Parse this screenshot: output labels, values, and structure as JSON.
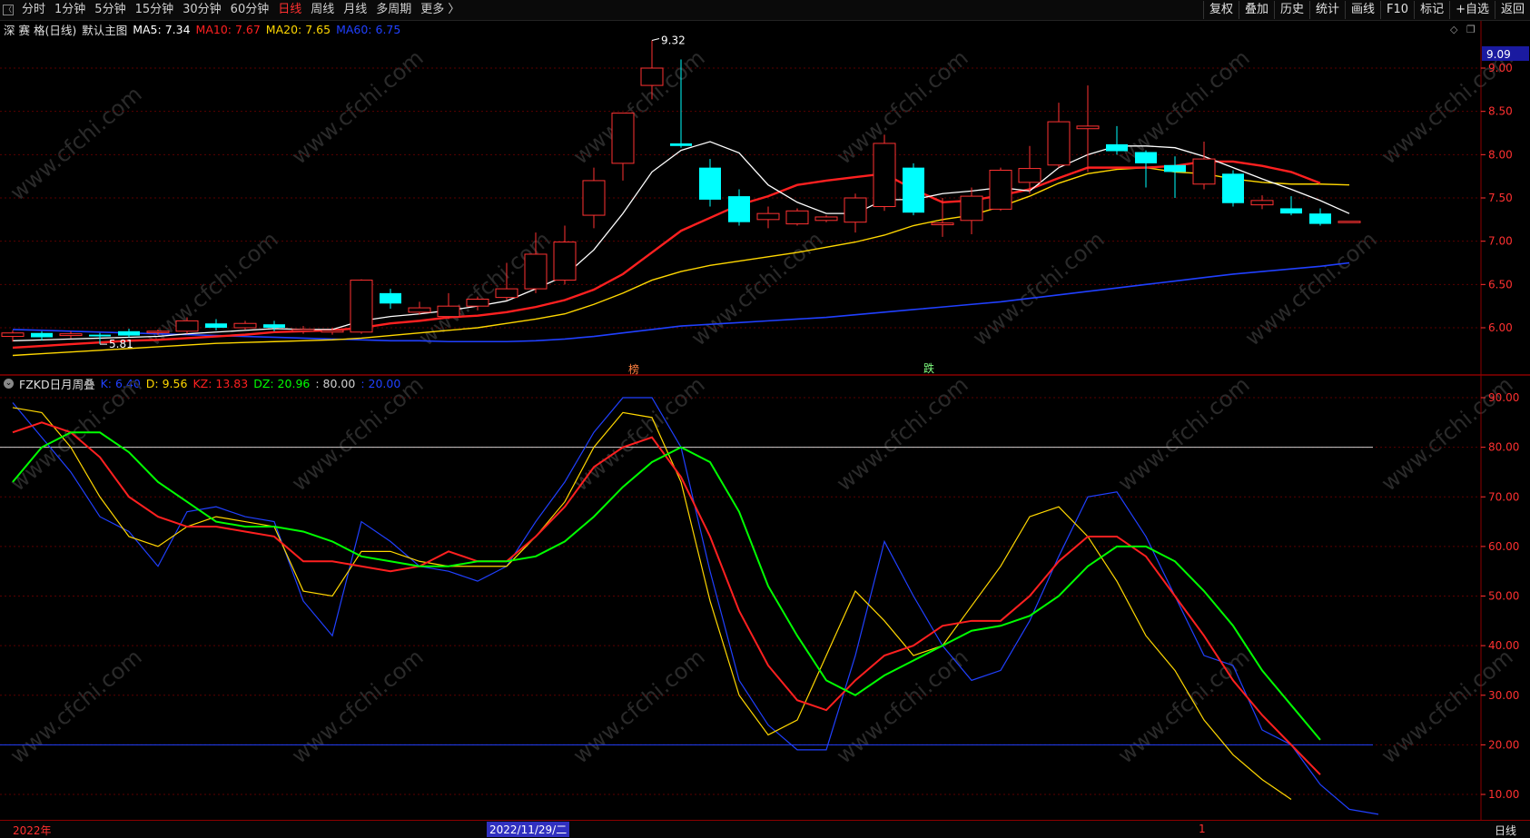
{
  "topbar": {
    "periods": [
      "分时",
      "1分钟",
      "5分钟",
      "15分钟",
      "30分钟",
      "60分钟",
      "日线",
      "周线",
      "月线",
      "多周期",
      "更多 〉"
    ],
    "active_period": "日线",
    "tools": [
      "复权",
      "叠加",
      "历史",
      "统计",
      "画线",
      "F10",
      "标记",
      "+自选",
      "返回"
    ]
  },
  "main_panel": {
    "stock_name": "深 赛 格(日线)",
    "template": "默认主图",
    "ma": [
      {
        "label": "MA5: 7.34",
        "color": "#ffffff"
      },
      {
        "label": "MA10: 7.67",
        "color": "#ff2020"
      },
      {
        "label": "MA20: 7.65",
        "color": "#ffd700"
      },
      {
        "label": "MA60: 6.75",
        "color": "#2040ff"
      }
    ],
    "price_ticks": [
      "9.00",
      "8.50",
      "8.00",
      "7.50",
      "7.00",
      "6.50",
      "6.00"
    ],
    "current_price_tag": "9.09",
    "high_label": "9.32",
    "low_label": "5.81",
    "markers": [
      "榜",
      "跌"
    ]
  },
  "indicator_panel": {
    "name": "FZKD日月周叠",
    "labels": [
      {
        "label": "K: 6.40",
        "color": "#2040ff"
      },
      {
        "label": "D: 9.56",
        "color": "#ffd700"
      },
      {
        "label": "KZ: 13.83",
        "color": "#ff2020"
      },
      {
        "label": "DZ: 20.96",
        "color": "#00ff00"
      },
      {
        "label": ": 80.00",
        "color": "#d0d0d0"
      },
      {
        "label": ": 20.00",
        "color": "#2040ff"
      }
    ],
    "ticks": [
      "90.00",
      "80.00",
      "70.00",
      "60.00",
      "50.00",
      "40.00",
      "30.00",
      "20.00",
      "10.00"
    ]
  },
  "bottombar": {
    "year_label": "2022年",
    "cursor_date": "2022/11/29/二",
    "month_mark": "1",
    "period": "日线"
  },
  "watermark": "www.cfchi.com",
  "colors": {
    "up": "#ff3232",
    "down": "#00ffff",
    "grid": "#5a0000",
    "axis": "#ff3030"
  },
  "chart_data": {
    "type": "candlestick",
    "candles": [
      {
        "o": 5.9,
        "c": 5.94,
        "h": 5.97,
        "l": 5.84
      },
      {
        "o": 5.94,
        "c": 5.89,
        "h": 5.96,
        "l": 5.85
      },
      {
        "o": 5.91,
        "c": 5.93,
        "h": 5.96,
        "l": 5.88
      },
      {
        "o": 5.92,
        "c": 5.9,
        "h": 5.94,
        "l": 5.81
      },
      {
        "o": 5.96,
        "c": 5.91,
        "h": 5.99,
        "l": 5.89
      },
      {
        "o": 5.95,
        "c": 5.96,
        "h": 5.98,
        "l": 5.92
      },
      {
        "o": 5.96,
        "c": 6.08,
        "h": 6.12,
        "l": 5.93
      },
      {
        "o": 6.05,
        "c": 6.0,
        "h": 6.1,
        "l": 5.97
      },
      {
        "o": 6.0,
        "c": 6.05,
        "h": 6.08,
        "l": 5.98
      },
      {
        "o": 6.04,
        "c": 6.0,
        "h": 6.08,
        "l": 5.96
      },
      {
        "o": 5.96,
        "c": 5.98,
        "h": 6.02,
        "l": 5.93
      },
      {
        "o": 5.95,
        "c": 5.97,
        "h": 6.0,
        "l": 5.92
      },
      {
        "o": 5.95,
        "c": 6.55,
        "h": 6.56,
        "l": 5.93
      },
      {
        "o": 6.4,
        "c": 6.28,
        "h": 6.45,
        "l": 6.22
      },
      {
        "o": 6.18,
        "c": 6.23,
        "h": 6.3,
        "l": 6.15
      },
      {
        "o": 6.13,
        "c": 6.25,
        "h": 6.4,
        "l": 6.1
      },
      {
        "o": 6.25,
        "c": 6.33,
        "h": 6.36,
        "l": 6.2
      },
      {
        "o": 6.35,
        "c": 6.45,
        "h": 6.75,
        "l": 6.32
      },
      {
        "o": 6.45,
        "c": 6.85,
        "h": 7.1,
        "l": 6.4
      },
      {
        "o": 6.55,
        "c": 6.99,
        "h": 7.18,
        "l": 6.5
      },
      {
        "o": 7.3,
        "c": 7.7,
        "h": 7.85,
        "l": 7.15
      },
      {
        "o": 7.9,
        "c": 8.48,
        "h": 8.48,
        "l": 7.7
      },
      {
        "o": 8.8,
        "c": 9.0,
        "h": 9.32,
        "l": 8.64
      },
      {
        "o": 8.13,
        "c": 8.1,
        "h": 9.1,
        "l": 8.08
      },
      {
        "o": 7.85,
        "c": 7.48,
        "h": 7.95,
        "l": 7.4
      },
      {
        "o": 7.52,
        "c": 7.22,
        "h": 7.6,
        "l": 7.18
      },
      {
        "o": 7.25,
        "c": 7.32,
        "h": 7.4,
        "l": 7.15
      },
      {
        "o": 7.2,
        "c": 7.35,
        "h": 7.38,
        "l": 7.18
      },
      {
        "o": 7.24,
        "c": 7.28,
        "h": 7.3,
        "l": 7.22
      },
      {
        "o": 7.22,
        "c": 7.5,
        "h": 7.55,
        "l": 7.1
      },
      {
        "o": 7.4,
        "c": 8.13,
        "h": 8.23,
        "l": 7.35
      },
      {
        "o": 7.85,
        "c": 7.33,
        "h": 7.9,
        "l": 7.3
      },
      {
        "o": 7.19,
        "c": 7.21,
        "h": 7.5,
        "l": 7.05
      },
      {
        "o": 7.24,
        "c": 7.52,
        "h": 7.62,
        "l": 7.08
      },
      {
        "o": 7.37,
        "c": 7.82,
        "h": 7.85,
        "l": 7.35
      },
      {
        "o": 7.68,
        "c": 7.84,
        "h": 8.1,
        "l": 7.55
      },
      {
        "o": 7.88,
        "c": 8.38,
        "h": 8.6,
        "l": 7.85
      },
      {
        "o": 8.3,
        "c": 8.33,
        "h": 8.8,
        "l": 7.8
      },
      {
        "o": 8.12,
        "c": 8.04,
        "h": 8.33,
        "l": 8.0
      },
      {
        "o": 8.03,
        "c": 7.9,
        "h": 8.05,
        "l": 7.62
      },
      {
        "o": 7.88,
        "c": 7.8,
        "h": 7.98,
        "l": 7.5
      },
      {
        "o": 7.66,
        "c": 7.95,
        "h": 8.15,
        "l": 7.6
      },
      {
        "o": 7.78,
        "c": 7.44,
        "h": 7.82,
        "l": 7.4
      },
      {
        "o": 7.42,
        "c": 7.47,
        "h": 7.53,
        "l": 7.37
      },
      {
        "o": 7.38,
        "c": 7.32,
        "h": 7.52,
        "l": 7.3
      },
      {
        "o": 7.32,
        "c": 7.2,
        "h": 7.38,
        "l": 7.18
      },
      {
        "o": 7.23,
        "c": 7.23,
        "h": 7.23,
        "l": 7.23
      }
    ],
    "ma5": [
      5.85,
      5.86,
      5.87,
      5.88,
      5.89,
      5.9,
      5.93,
      5.95,
      5.97,
      5.99,
      5.98,
      5.98,
      6.08,
      6.13,
      6.16,
      6.2,
      6.25,
      6.31,
      6.45,
      6.6,
      6.9,
      7.32,
      7.8,
      8.05,
      8.15,
      8.02,
      7.65,
      7.45,
      7.32,
      7.32,
      7.48,
      7.48,
      7.55,
      7.58,
      7.62,
      7.58,
      7.85,
      8.0,
      8.1,
      8.1,
      8.08,
      7.98,
      7.85,
      7.72,
      7.6,
      7.47,
      7.32
    ],
    "ma10": [
      5.77,
      5.79,
      5.81,
      5.83,
      5.85,
      5.86,
      5.88,
      5.9,
      5.92,
      5.95,
      5.96,
      5.97,
      6.0,
      6.05,
      6.08,
      6.12,
      6.14,
      6.18,
      6.24,
      6.32,
      6.44,
      6.62,
      6.87,
      7.12,
      7.27,
      7.42,
      7.52,
      7.65,
      7.7,
      7.74,
      7.78,
      7.6,
      7.45,
      7.47,
      7.53,
      7.6,
      7.73,
      7.85,
      7.85,
      7.85,
      7.87,
      7.92,
      7.92,
      7.87,
      7.8,
      7.67
    ],
    "ma20": [
      5.68,
      5.7,
      5.72,
      5.74,
      5.76,
      5.78,
      5.8,
      5.82,
      5.83,
      5.84,
      5.85,
      5.86,
      5.88,
      5.91,
      5.94,
      5.97,
      6.0,
      6.05,
      6.1,
      6.16,
      6.27,
      6.4,
      6.55,
      6.65,
      6.72,
      6.77,
      6.82,
      6.87,
      6.93,
      6.99,
      7.07,
      7.18,
      7.25,
      7.3,
      7.4,
      7.52,
      7.67,
      7.78,
      7.83,
      7.85,
      7.8,
      7.78,
      7.72,
      7.68,
      7.66,
      7.66,
      7.65
    ],
    "ma60": [
      5.98,
      5.97,
      5.96,
      5.95,
      5.94,
      5.93,
      5.92,
      5.91,
      5.9,
      5.89,
      5.88,
      5.87,
      5.86,
      5.85,
      5.85,
      5.84,
      5.84,
      5.84,
      5.85,
      5.87,
      5.9,
      5.94,
      5.98,
      6.02,
      6.04,
      6.06,
      6.08,
      6.1,
      6.12,
      6.15,
      6.18,
      6.21,
      6.24,
      6.27,
      6.3,
      6.34,
      6.38,
      6.42,
      6.46,
      6.5,
      6.54,
      6.58,
      6.62,
      6.65,
      6.68,
      6.71,
      6.75
    ],
    "k": [
      89,
      82,
      75,
      66,
      63,
      56,
      67,
      68,
      66,
      65,
      49,
      42,
      65,
      61,
      56,
      55,
      53,
      56,
      65,
      73,
      83,
      90,
      90,
      80,
      55,
      33,
      24,
      19,
      19,
      38,
      61,
      50,
      40,
      33,
      35,
      45,
      58,
      70,
      71,
      62,
      50,
      38,
      36,
      23,
      20,
      12,
      7,
      6
    ],
    "d": [
      88,
      87,
      80,
      70,
      62,
      60,
      64,
      66,
      65,
      64,
      51,
      50,
      59,
      59,
      57,
      56,
      56,
      56,
      62,
      69,
      80,
      87,
      86,
      73,
      49,
      30,
      22,
      25,
      38,
      51,
      45,
      38,
      40,
      48,
      56,
      66,
      68,
      62,
      53,
      42,
      35,
      25,
      18,
      13,
      9
    ],
    "kz": [
      83,
      85,
      83,
      78,
      70,
      66,
      64,
      64,
      63,
      62,
      57,
      57,
      56,
      55,
      56,
      59,
      57,
      57,
      62,
      68,
      76,
      80,
      82,
      74,
      62,
      47,
      36,
      29,
      27,
      33,
      38,
      40,
      44,
      45,
      45,
      50,
      57,
      62,
      62,
      58,
      50,
      42,
      33,
      26,
      20,
      14
    ],
    "dz": [
      73,
      80,
      83,
      83,
      79,
      73,
      69,
      65,
      64,
      64,
      63,
      61,
      58,
      57,
      56,
      56,
      57,
      57,
      58,
      61,
      66,
      72,
      77,
      80,
      77,
      67,
      52,
      42,
      33,
      30,
      34,
      37,
      40,
      43,
      44,
      46,
      50,
      56,
      60,
      60,
      57,
      51,
      44,
      35,
      28,
      21
    ]
  }
}
